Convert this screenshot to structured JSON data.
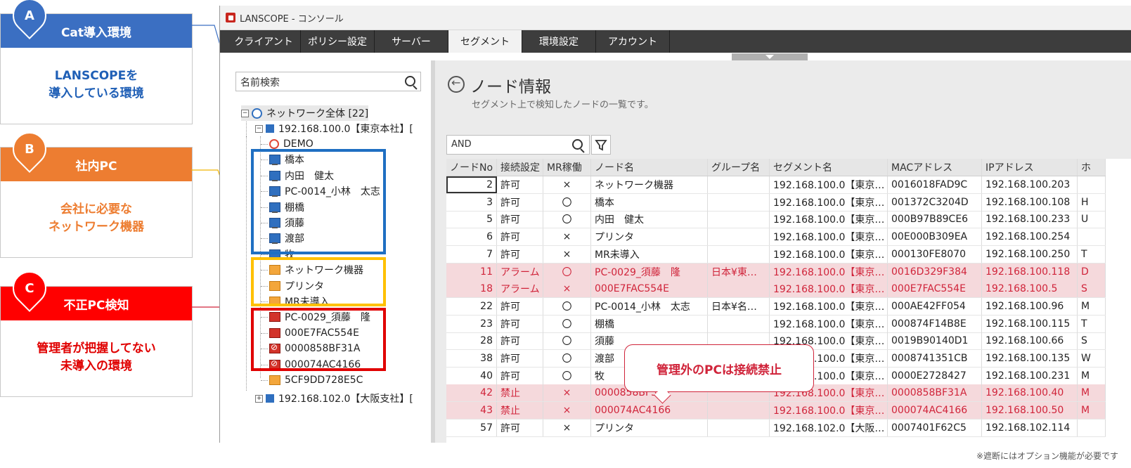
{
  "cards": [
    {
      "letter": "A",
      "title": "Cat導入環境",
      "body": "LANSCOPEを\n導入している環境",
      "color": "#3b6fc2"
    },
    {
      "letter": "B",
      "title": "社内PC",
      "body": "会社に必要な\nネットワーク機器",
      "color": "#ed7d31"
    },
    {
      "letter": "C",
      "title": "不正PC検知",
      "body": "管理者が把握してない\n未導入の環境",
      "color": "#ff0000"
    }
  ],
  "window": {
    "title": "LANSCOPE - コンソール",
    "menu": [
      "クライアント",
      "ポリシー設定",
      "サーバー",
      "セグメント",
      "環境設定",
      "アカウント"
    ],
    "active_menu": "セグメント"
  },
  "tree": {
    "search_placeholder": "名前検索",
    "root": "ネットワーク全体 [22]",
    "segment1": "192.168.100.0【東京本社】[",
    "segment2": "192.168.102.0【大阪支社】[",
    "items": [
      {
        "label": "DEMO",
        "icon": "demo-icon"
      },
      {
        "label": "橋本",
        "icon": "pc-icon"
      },
      {
        "label": "内田　健太",
        "icon": "pc-icon"
      },
      {
        "label": "PC-0014_小林　太志",
        "icon": "pc-icon"
      },
      {
        "label": "棚橋",
        "icon": "pc-icon"
      },
      {
        "label": "須藤",
        "icon": "pc-icon"
      },
      {
        "label": "渡部",
        "icon": "pc-icon"
      },
      {
        "label": "牧",
        "icon": "pc-icon"
      },
      {
        "label": "ネットワーク機器",
        "icon": "device-icon"
      },
      {
        "label": "プリンタ",
        "icon": "device-icon"
      },
      {
        "label": "MR未導入",
        "icon": "device-icon"
      },
      {
        "label": "PC-0029_須藤　隆",
        "icon": "alarm-pc-icon"
      },
      {
        "label": "000E7FAC554E",
        "icon": "alarm-pc-icon"
      },
      {
        "label": "0000858BF31A",
        "icon": "blocked-icon"
      },
      {
        "label": "000074AC4166",
        "icon": "blocked-icon"
      },
      {
        "label": "5CF9DD728E5C",
        "icon": "device-icon"
      }
    ]
  },
  "main": {
    "title": "ノード情報",
    "subtitle": "セグメント上で検知したノードの一覧です。",
    "filter_value": "AND",
    "columns": [
      "ノードNo",
      "接続設定",
      "MR稼働",
      "ノード名",
      "グループ名",
      "セグメント名",
      "MACアドレス",
      "IPアドレス",
      "ホ"
    ],
    "rows": [
      {
        "no": "2",
        "conn": "許可",
        "mr": "×",
        "name": "ネットワーク機器",
        "group": "",
        "seg": "192.168.100.0【東京…",
        "mac": "0016018FAD9C",
        "ip": "192.168.100.203",
        "h": "",
        "alarm": false
      },
      {
        "no": "3",
        "conn": "許可",
        "mr": "〇",
        "name": "橋本",
        "group": "",
        "seg": "192.168.100.0【東京…",
        "mac": "001372C3204D",
        "ip": "192.168.100.108",
        "h": "H",
        "alarm": false
      },
      {
        "no": "5",
        "conn": "許可",
        "mr": "〇",
        "name": "内田　健太",
        "group": "",
        "seg": "192.168.100.0【東京…",
        "mac": "000B97B89CE6",
        "ip": "192.168.100.233",
        "h": "U",
        "alarm": false
      },
      {
        "no": "6",
        "conn": "許可",
        "mr": "×",
        "name": "プリンタ",
        "group": "",
        "seg": "192.168.100.0【東京…",
        "mac": "00E000B309EA",
        "ip": "192.168.100.254",
        "h": "",
        "alarm": false
      },
      {
        "no": "7",
        "conn": "許可",
        "mr": "×",
        "name": "MR未導入",
        "group": "",
        "seg": "192.168.100.0【東京…",
        "mac": "000130FE8070",
        "ip": "192.168.100.250",
        "h": "T",
        "alarm": false
      },
      {
        "no": "11",
        "conn": "アラーム",
        "mr": "〇",
        "name": "PC-0029_須藤　隆",
        "group": "日本¥東…",
        "seg": "192.168.100.0【東京…",
        "mac": "0016D329F384",
        "ip": "192.168.100.118",
        "h": "D",
        "alarm": true
      },
      {
        "no": "18",
        "conn": "アラーム",
        "mr": "×",
        "name": "000E7FAC554E",
        "group": "",
        "seg": "192.168.100.0【東京…",
        "mac": "000E7FAC554E",
        "ip": "192.168.100.5",
        "h": "S",
        "alarm": true
      },
      {
        "no": "22",
        "conn": "許可",
        "mr": "〇",
        "name": "PC-0014_小林　太志",
        "group": "日本¥名…",
        "seg": "192.168.100.0【東京…",
        "mac": "000AE42FF054",
        "ip": "192.168.100.96",
        "h": "M",
        "alarm": false
      },
      {
        "no": "23",
        "conn": "許可",
        "mr": "〇",
        "name": "棚橋",
        "group": "",
        "seg": "192.168.100.0【東京…",
        "mac": "000874F14B8E",
        "ip": "192.168.100.115",
        "h": "T",
        "alarm": false
      },
      {
        "no": "28",
        "conn": "許可",
        "mr": "〇",
        "name": "須藤",
        "group": "",
        "seg": "192.168.100.0【東京…",
        "mac": "0019B90140D1",
        "ip": "192.168.100.66",
        "h": "S",
        "alarm": false
      },
      {
        "no": "38",
        "conn": "許可",
        "mr": "〇",
        "name": "渡部",
        "group": "",
        "seg": "192.168.100.0【東京…",
        "mac": "0008741351CB",
        "ip": "192.168.100.135",
        "h": "W",
        "alarm": false
      },
      {
        "no": "40",
        "conn": "許可",
        "mr": "〇",
        "name": "牧",
        "group": "",
        "seg": "192.168.100.0【東京…",
        "mac": "0000E2728427",
        "ip": "192.168.100.231",
        "h": "M",
        "alarm": false
      },
      {
        "no": "42",
        "conn": "禁止",
        "mr": "×",
        "name": "0000858BF31A",
        "group": "",
        "seg": "192.168.100.0【東京…",
        "mac": "0000858BF31A",
        "ip": "192.168.100.40",
        "h": "M",
        "alarm": true
      },
      {
        "no": "43",
        "conn": "禁止",
        "mr": "×",
        "name": "000074AC4166",
        "group": "",
        "seg": "192.168.100.0【東京…",
        "mac": "000074AC4166",
        "ip": "192.168.100.50",
        "h": "M",
        "alarm": true
      },
      {
        "no": "57",
        "conn": "許可",
        "mr": "×",
        "name": "プリンタ",
        "group": "",
        "seg": "192.168.102.0【大阪…",
        "mac": "0007401F62C5",
        "ip": "192.168.102.114",
        "h": "",
        "alarm": false
      }
    ]
  },
  "callout": "管理外のPCは接続禁止",
  "footnote": "※遮断にはオプション機能が必要です"
}
